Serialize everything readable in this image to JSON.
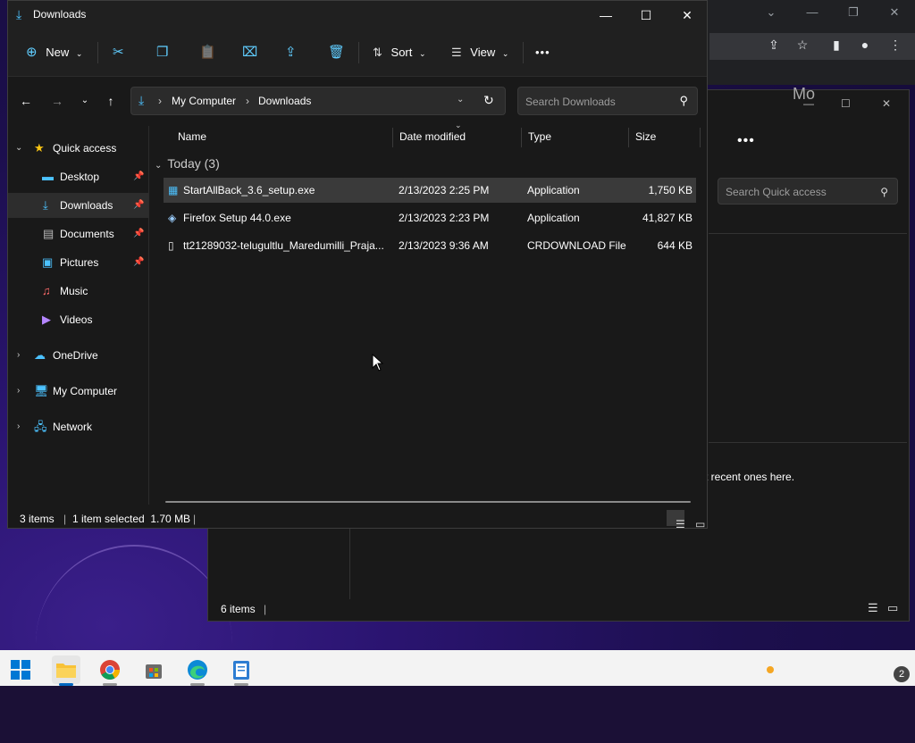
{
  "window": {
    "title": "Downloads",
    "controls": {
      "minimize": "—",
      "maximize": "☐",
      "close": "✕"
    }
  },
  "toolbar": {
    "new_label": "New",
    "sort_label": "Sort",
    "view_label": "View",
    "more_label": "•••"
  },
  "navigation": {
    "breadcrumb": [
      "My Computer",
      "Downloads"
    ],
    "search_placeholder": "Search Downloads"
  },
  "sidebar": {
    "items": [
      {
        "label": "Quick access",
        "icon": "star-icon"
      },
      {
        "label": "Desktop",
        "icon": "desktop-icon"
      },
      {
        "label": "Downloads",
        "icon": "download-icon"
      },
      {
        "label": "Documents",
        "icon": "document-icon"
      },
      {
        "label": "Pictures",
        "icon": "picture-icon"
      },
      {
        "label": "Music",
        "icon": "music-icon"
      },
      {
        "label": "Videos",
        "icon": "video-icon"
      },
      {
        "label": "OneDrive",
        "icon": "cloud-icon"
      },
      {
        "label": "My Computer",
        "icon": "computer-icon"
      },
      {
        "label": "Network",
        "icon": "network-icon"
      }
    ]
  },
  "columns": {
    "name": "Name",
    "date": "Date modified",
    "type": "Type",
    "size": "Size"
  },
  "group": {
    "label": "Today (3)"
  },
  "files": [
    {
      "name": "StartAllBack_3.6_setup.exe",
      "date": "2/13/2023 2:25 PM",
      "type": "Application",
      "size": "1,750 KB",
      "icon": "exe-icon"
    },
    {
      "name": "Firefox Setup 44.0.exe",
      "date": "2/13/2023 2:23 PM",
      "type": "Application",
      "size": "41,827 KB",
      "icon": "exe-icon"
    },
    {
      "name": "tt21289032-telugultlu_Maredumilli_Praja...",
      "date": "2/13/2023 9:36 AM",
      "type": "CRDOWNLOAD File",
      "size": "644 KB",
      "icon": "file-icon"
    }
  ],
  "status": {
    "count": "3 items",
    "selection": "1 item selected  1.70 MB"
  },
  "background_window": {
    "search_placeholder": "Search Quick access",
    "hint": "t recent ones here.",
    "status": "6 items",
    "more_label": "•••",
    "header_partial": "Mo"
  },
  "colors": {
    "accent": "#60cdff",
    "window_bg": "#191919",
    "selection": "#3a3a3a"
  }
}
